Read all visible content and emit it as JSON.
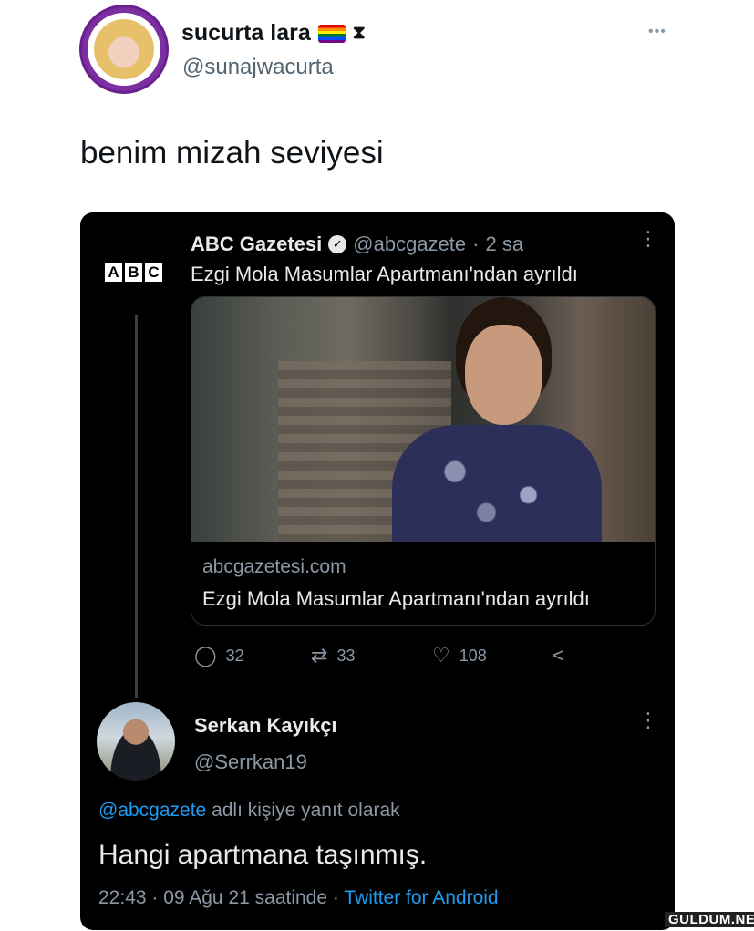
{
  "tweet": {
    "display_name": "sucurta lara",
    "handle": "@sunajwacurta",
    "more_icon": "more-horizontal-icon",
    "text": "benim mizah seviyesi"
  },
  "embedded": {
    "news_post": {
      "logo_letters": [
        "A",
        "B",
        "C"
      ],
      "name": "ABC Gazetesi",
      "handle": "@abcgazete",
      "separator": "·",
      "time": "2 sa",
      "text": "Ezgi Mola Masumlar Apartmanı'ndan ayrıldı",
      "link_card": {
        "domain": "abcgazetesi.com",
        "title": "Ezgi Mola Masumlar Apartmanı'ndan ayrıldı"
      },
      "actions": {
        "replies": "32",
        "retweets": "33",
        "likes": "108"
      }
    },
    "reply_post": {
      "name": "Serkan Kayıkçı",
      "handle": "@Serrkan19",
      "replying_mention": "@abcgazete",
      "replying_suffix": "adlı kişiye yanıt olarak",
      "text": "Hangi apartmana taşınmış.",
      "time": "22:43 · 09 Ağu 21 saatinde",
      "separator": "·",
      "source": "Twitter for Android"
    }
  },
  "watermark": "GULDUM.NET",
  "colors": {
    "link_blue": "#1d9bf0",
    "dark_bg": "#000000",
    "muted": "#8b98a5"
  }
}
